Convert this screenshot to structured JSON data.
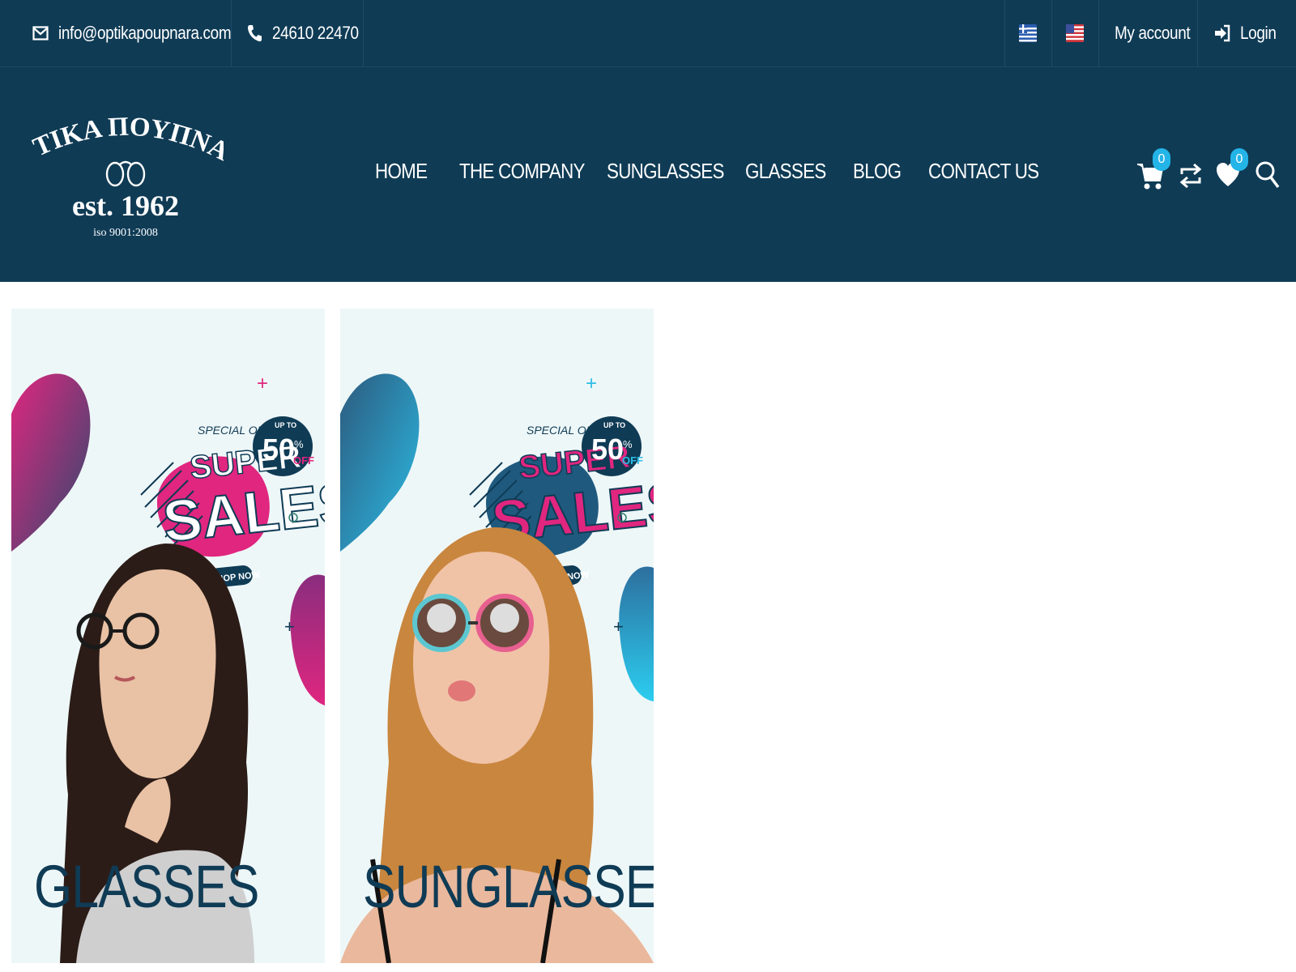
{
  "topbar": {
    "email": "info@optikapoupnara.com",
    "phone": "24610 22470",
    "languages": [
      {
        "name": "greek-flag-icon"
      },
      {
        "name": "us-flag-icon"
      }
    ],
    "my_account": "My account",
    "login": "Login"
  },
  "header": {
    "logo": {
      "line1": "ΟΠΤΙΚΑ ΠΟΥΠΝΑΡΑ",
      "line2": "est. 1962",
      "line3": "iso 9001:2008"
    },
    "nav": [
      "HOME",
      "THE COMPANY",
      "SUNGLASSES",
      "GLASSES",
      "BLOG",
      "CONTACT US"
    ],
    "cart_count": "0",
    "wishlist_count": "0"
  },
  "cards": [
    {
      "label": "GLASSES",
      "special_offer": "SPECIAL OFFER",
      "headline1": "SUPER",
      "headline2": "SALES",
      "up_to": "UP TO",
      "discount": "50",
      "percent": "%",
      "off": "OFF",
      "cta": "SHOP NOW"
    },
    {
      "label": "SUNGLASSES",
      "special_offer": "SPECIAL OFFER",
      "headline1": "SUPER",
      "headline2": "SALES",
      "up_to": "UP TO",
      "discount": "50",
      "percent": "%",
      "off": "OFF",
      "cta": "SHOP NOW"
    }
  ],
  "colors": {
    "brand_navy": "#0f3b55",
    "badge_blue": "#23b4e8",
    "magenta": "#e0267f",
    "cyan": "#2bbde6"
  }
}
